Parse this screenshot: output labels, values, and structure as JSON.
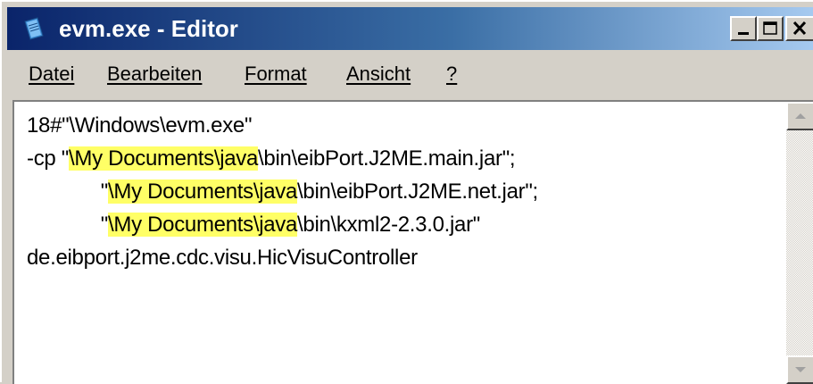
{
  "window": {
    "title": "evm.exe - Editor",
    "icon": "notepad-icon",
    "controls": {
      "minimize": "minimize-icon",
      "maximize": "maximize-icon",
      "close": "close-icon"
    }
  },
  "menu": {
    "items": [
      {
        "label": "Datei"
      },
      {
        "label": "Bearbeiten"
      },
      {
        "label": "Format"
      },
      {
        "label": "Ansicht"
      },
      {
        "label": "?"
      }
    ]
  },
  "editor": {
    "lines": [
      {
        "segments": [
          {
            "text": "18#\"\\Windows\\evm.exe\"",
            "hl": false
          }
        ]
      },
      {
        "segments": [
          {
            "text": "-cp \"",
            "hl": false
          },
          {
            "text": "\\My Documents\\java",
            "hl": true
          },
          {
            "text": "\\bin\\eibPort.J2ME.main.jar\";",
            "hl": false
          }
        ]
      },
      {
        "segments": [
          {
            "text": "             \"",
            "hl": false
          },
          {
            "text": "\\My Documents\\java",
            "hl": true
          },
          {
            "text": "\\bin\\eibPort.J2ME.net.jar\";",
            "hl": false
          }
        ]
      },
      {
        "segments": [
          {
            "text": "             \"",
            "hl": false
          },
          {
            "text": "\\My Documents\\java",
            "hl": true
          },
          {
            "text": "\\bin\\kxml2-2.3.0.jar\"",
            "hl": false
          }
        ]
      },
      {
        "segments": [
          {
            "text": "de.eibport.j2me.cdc.visu.HicVisuController",
            "hl": false
          }
        ]
      }
    ],
    "highlight_color": "#ffff66"
  },
  "colors": {
    "titlebar_start": "#0a246a",
    "titlebar_end": "#a6caf0",
    "chrome": "#d4d0c8"
  }
}
